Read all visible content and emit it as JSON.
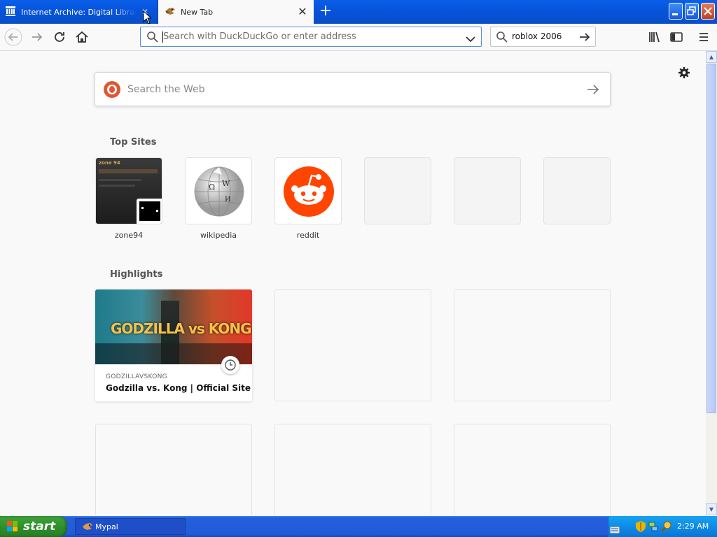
{
  "tabs": [
    {
      "title": "Internet Archive: Digital Library of Free & Borrowable Books, Movies, Music & Wayback Machine",
      "icon": "archive-icon",
      "active": false
    },
    {
      "title": "New Tab",
      "icon": "mypal-icon",
      "active": true
    }
  ],
  "toolbar": {
    "url_placeholder": "Search with DuckDuckGo or enter address",
    "search_value": "roblox 2006"
  },
  "newtab": {
    "web_search_placeholder": "Search the Web",
    "top_sites_title": "Top Sites",
    "highlights_title": "Highlights",
    "top_sites": [
      {
        "label": "zone94"
      },
      {
        "label": "wikipedia"
      },
      {
        "label": "reddit"
      },
      {
        "label": ""
      },
      {
        "label": ""
      },
      {
        "label": ""
      }
    ],
    "highlights": [
      {
        "host": "GODZILLAVSKONG",
        "title": "Godzilla vs. Kong | Official Site",
        "image_text": "GODZILLA vs KONG"
      }
    ]
  },
  "taskbar": {
    "start_label": "start",
    "tasks": [
      {
        "label": "Mypal"
      }
    ],
    "clock": "2:29 AM"
  },
  "colors": {
    "accent": "#0a5ee8",
    "reddit": "#ff4500",
    "duckduckgo": "#de5833",
    "taskbar": "#245edb",
    "start": "#2d8c2a"
  }
}
